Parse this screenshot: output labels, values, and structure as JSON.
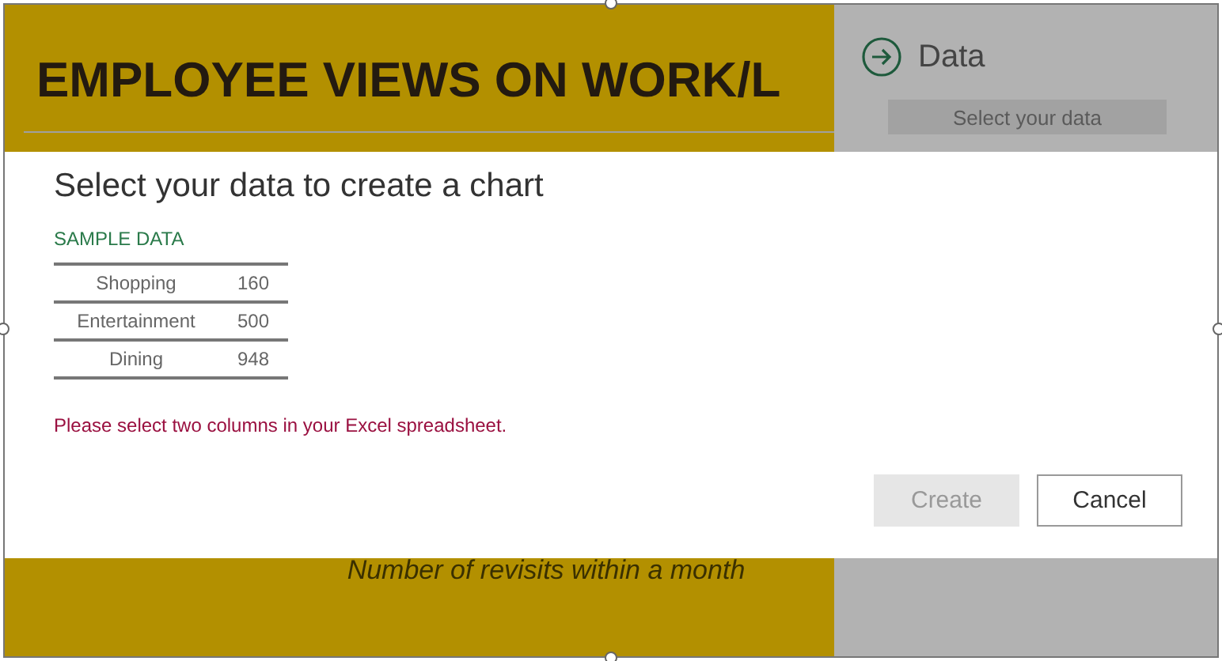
{
  "slide": {
    "title": "EMPLOYEE VIEWS ON WORK/L",
    "caption": "Number of revisits within a month"
  },
  "panel": {
    "title": "Data",
    "button": "Select your data"
  },
  "dialog": {
    "title": "Select your data to create a chart",
    "sample_label": "SAMPLE DATA",
    "rows": [
      {
        "name": "Shopping",
        "value": "160"
      },
      {
        "name": "Entertainment",
        "value": "500"
      },
      {
        "name": "Dining",
        "value": "948"
      }
    ],
    "message": "Please select two columns in your Excel spreadsheet.",
    "buttons": [
      {
        "label": "Create",
        "disabled": true
      },
      {
        "label": "Cancel",
        "disabled": false
      }
    ]
  }
}
